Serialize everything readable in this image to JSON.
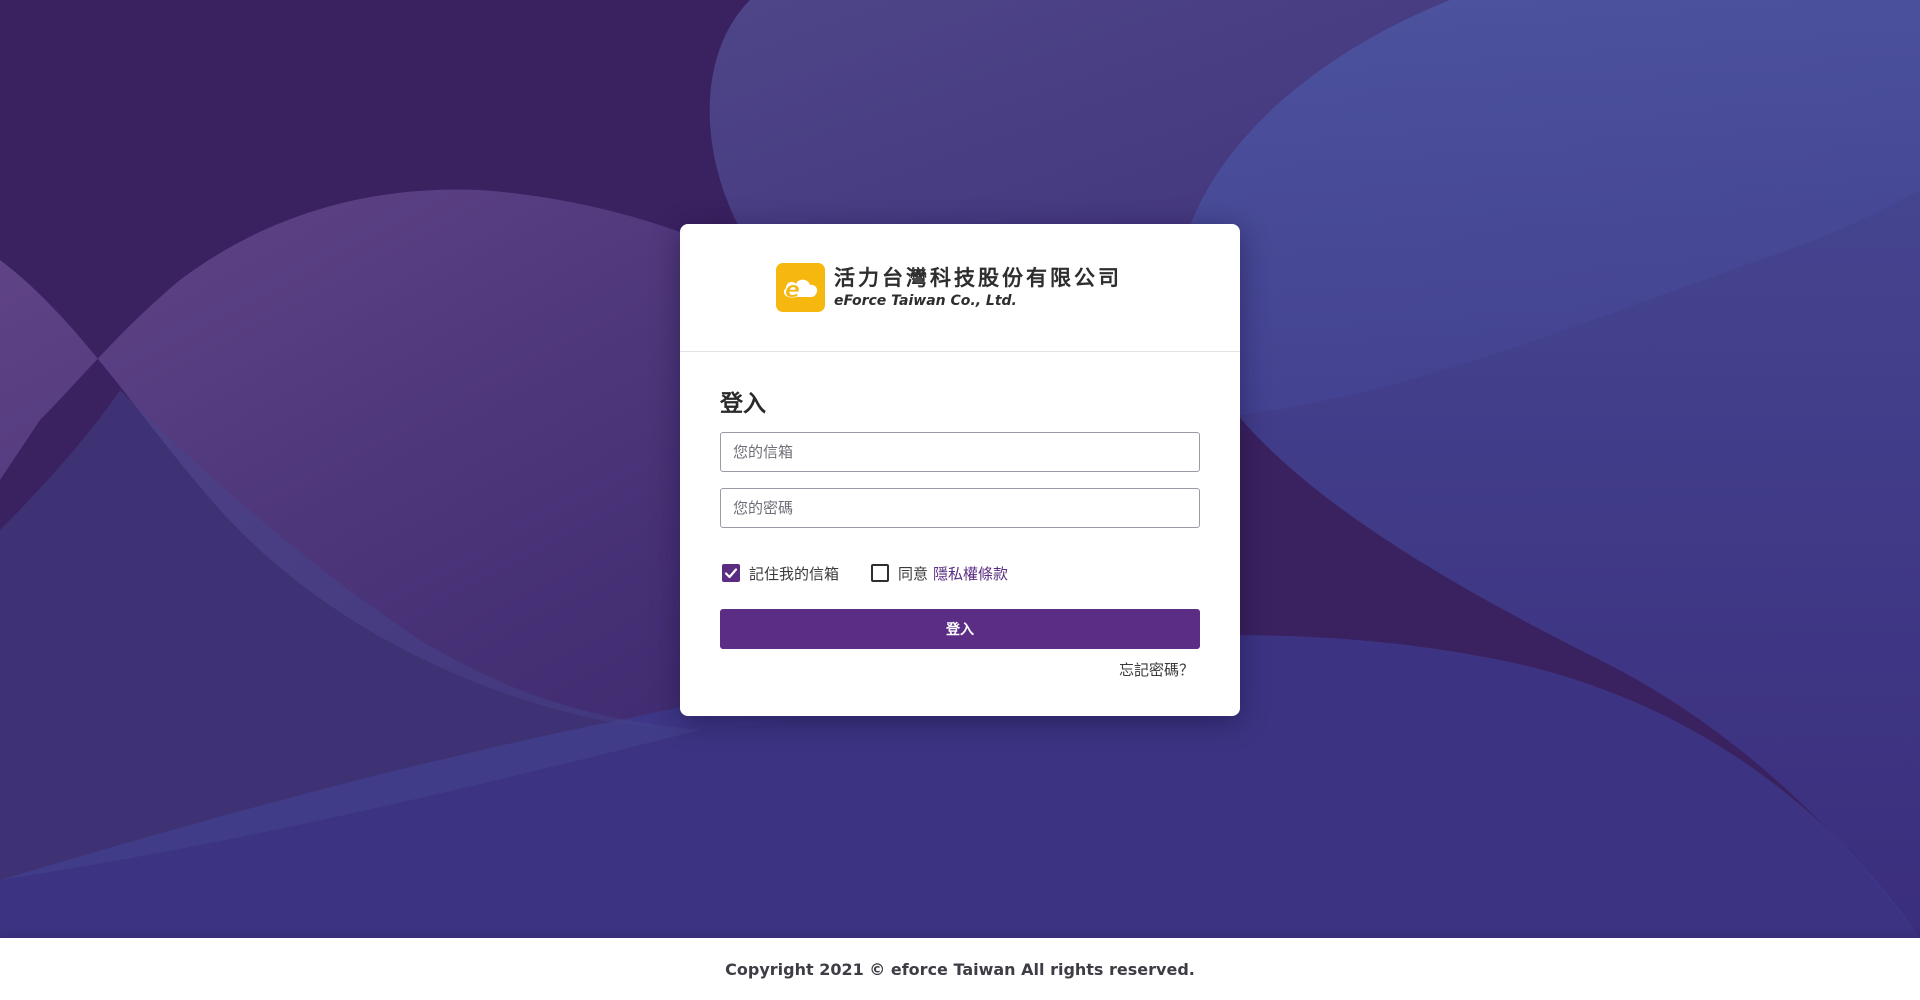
{
  "brand": {
    "name_zh": "活力台灣科技股份有限公司",
    "name_en": "eForce Taiwan Co., Ltd.",
    "logo_icon": "cloud-e-logo-icon",
    "logo_color": "#f6b80e"
  },
  "login": {
    "title": "登入",
    "email_placeholder": "您的信箱",
    "email_value": "",
    "password_placeholder": "您的密碼",
    "password_value": "",
    "remember_label": "記住我的信箱",
    "remember_checked": true,
    "agree_label": "同意",
    "agree_checked": false,
    "privacy_link": "隱私權條款",
    "submit_label": "登入",
    "forgot_label": "忘記密碼？"
  },
  "footer": {
    "copyright": "Copyright 2021 © eforce Taiwan All rights reserved."
  },
  "colors": {
    "accent": "#5b2d85",
    "background": "#3a2160",
    "link": "#5a2d82"
  }
}
